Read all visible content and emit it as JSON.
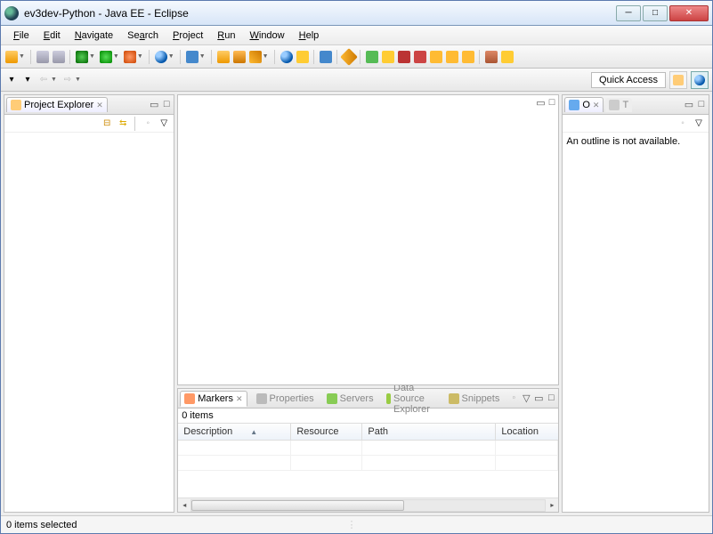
{
  "title": "ev3dev-Python - Java EE - Eclipse",
  "menu": {
    "file": "File",
    "edit": "Edit",
    "navigate": "Navigate",
    "search": "Search",
    "project": "Project",
    "run": "Run",
    "window": "Window",
    "help": "Help"
  },
  "quick_access": "Quick Access",
  "project_explorer": {
    "title": "Project Explorer"
  },
  "outline": {
    "tab_o": "O",
    "tab_t": "T",
    "empty": "An outline is not available."
  },
  "bottom": {
    "markers": "Markers",
    "properties": "Properties",
    "servers": "Servers",
    "data_source": "Data Source Explorer",
    "snippets": "Snippets",
    "items": "0 items",
    "cols": {
      "description": "Description",
      "resource": "Resource",
      "path": "Path",
      "location": "Location"
    }
  },
  "status": "0 items selected"
}
